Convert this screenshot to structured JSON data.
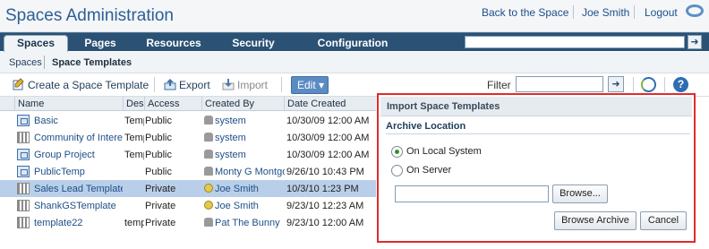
{
  "header": {
    "title": "Spaces Administration",
    "links": [
      "Back to the Space",
      "Joe Smith",
      "Logout"
    ]
  },
  "tabs": [
    {
      "label": "Spaces",
      "active": true
    },
    {
      "label": "Pages",
      "active": false
    },
    {
      "label": "Resources",
      "active": false
    },
    {
      "label": "Security",
      "active": false
    },
    {
      "label": "Configuration",
      "active": false
    }
  ],
  "breadcrumb": {
    "root": "Spaces",
    "current": "Space Templates"
  },
  "toolbar": {
    "create_label": "Create a Space Template",
    "export_label": "Export",
    "import_label": "Import",
    "edit_label": "Edit",
    "filter_label": "Filter",
    "filter_value": ""
  },
  "grid": {
    "columns": [
      "Name",
      "Description",
      "Access",
      "Created By",
      "Date Created"
    ],
    "rows": [
      {
        "name": "Basic",
        "desc": "Temp",
        "access": "Public",
        "created_by": "system",
        "date": "10/30/09 12:00 AM",
        "icon": "space-icon",
        "user_icon": "system-user-icon",
        "selected": false
      },
      {
        "name": "Community of Intere",
        "desc": "Temp",
        "access": "Public",
        "created_by": "system",
        "date": "10/30/09 12:00 AM",
        "icon": "template-icon",
        "user_icon": "system-user-icon",
        "selected": false
      },
      {
        "name": "Group Project",
        "desc": "Temp",
        "access": "Public",
        "created_by": "system",
        "date": "10/30/09 12:00 AM",
        "icon": "space-icon",
        "user_icon": "system-user-icon",
        "selected": false
      },
      {
        "name": "PublicTemp",
        "desc": "",
        "access": "Public",
        "created_by": "Monty G Montgo",
        "date": "9/26/10 10:43 PM",
        "icon": "space-icon",
        "user_icon": "system-user-icon",
        "selected": false
      },
      {
        "name": "Sales Lead Template",
        "desc": "",
        "access": "Private",
        "created_by": "Joe Smith",
        "date": "10/3/10 1:23 PM",
        "icon": "template-icon",
        "user_icon": "person-icon",
        "selected": true
      },
      {
        "name": "ShankGSTemplate",
        "desc": "",
        "access": "Private",
        "created_by": "Joe Smith",
        "date": "9/23/10 12:23 AM",
        "icon": "template-icon",
        "user_icon": "person-icon",
        "selected": false
      },
      {
        "name": "template22",
        "desc": "temp",
        "access": "Private",
        "created_by": "Pat The Bunny",
        "date": "9/23/10 12:00 AM",
        "icon": "template-icon",
        "user_icon": "system-user-icon",
        "selected": false
      }
    ]
  },
  "import_panel": {
    "title": "Import Space Templates",
    "section_label": "Archive Location",
    "options": [
      {
        "label": "On Local System",
        "checked": true
      },
      {
        "label": "On Server",
        "checked": false
      }
    ],
    "file_value": "",
    "browse_label": "Browse...",
    "browse_archive_label": "Browse Archive",
    "cancel_label": "Cancel"
  }
}
